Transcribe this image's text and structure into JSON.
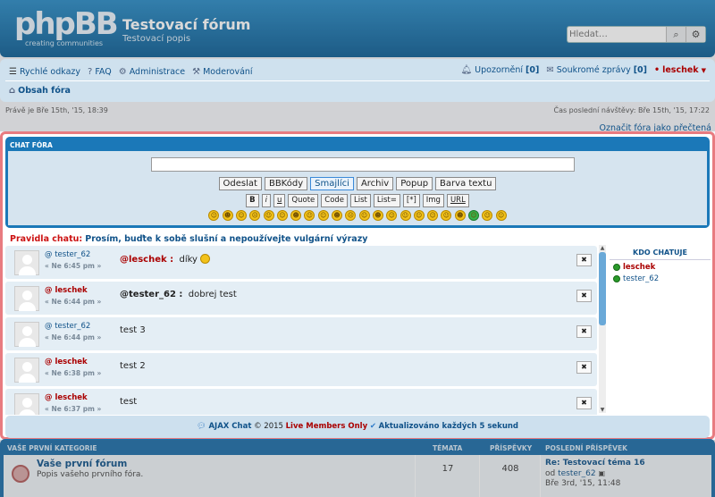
{
  "header": {
    "logo_text": "phpBB",
    "logo_sub": "creating communities",
    "site_title": "Testovací fórum",
    "site_desc": "Testovací popis",
    "search_placeholder": "Hledat…"
  },
  "nav": {
    "quick_links": "Rychlé odkazy",
    "faq": "FAQ",
    "admin": "Administrace",
    "moderate": "Moderování",
    "notifications": "Upozornění",
    "notifications_count": "[0]",
    "pm": "Soukromé zprávy",
    "pm_count": "[0]",
    "username": "leschek",
    "breadcrumb": "Obsah fóra"
  },
  "dates": {
    "now": "Právě je Bře 15th, '15, 18:39",
    "last_visit": "Čas poslední návštěvy: Bře 15th, '15, 17:22",
    "mark_read": "Označit fóra jako přečtená"
  },
  "chat": {
    "title": "CHAT FÓRA",
    "buttons_top": [
      "Odeslat",
      "BBKódy",
      "Smajlíci",
      "Archiv",
      "Popup",
      "Barva textu"
    ],
    "buttons_bb": [
      "B",
      "i",
      "u",
      "Quote",
      "Code",
      "List",
      "List=",
      "[*]",
      "Img",
      "URL"
    ],
    "smiley_count": 22,
    "rules_label": "Pravidla chatu:",
    "rules_text": "Prosím, buďte k sobě slušní a nepoužívejte vulgární výrazy",
    "messages": [
      {
        "user": "@ tester_62",
        "time": "« Ne 6:45 pm »",
        "to": "@leschek :",
        "text": "díky"
      },
      {
        "user": "@ leschek",
        "time": "« Ne 6:44 pm »",
        "to": "@tester_62 :",
        "text": "dobrej test"
      },
      {
        "user": "@ tester_62",
        "time": "« Ne 6:44 pm »",
        "to": "",
        "text": "test 3"
      },
      {
        "user": "@ leschek",
        "time": "« Ne 6:38 pm »",
        "to": "",
        "text": "test 2"
      },
      {
        "user": "@ leschek",
        "time": "« Ne 6:37 pm »",
        "to": "",
        "text": "test"
      }
    ],
    "delete_symbol": "✖",
    "online_title": "KDO CHATUJE",
    "online_users": [
      "leschek",
      "tester_62"
    ],
    "footer": {
      "ajax": "AJAX Chat",
      "copy": "© 2015",
      "live": "Live Members Only",
      "updated": "Aktualizováno každých 5 sekund"
    }
  },
  "forum": {
    "category": "VAŠE PRVNÍ KATEGORIE",
    "col_topics": "TÉMATA",
    "col_posts": "PŘÍSPĚVKY",
    "col_last": "POSLEDNÍ PŘÍSPĚVEK",
    "name": "Vaše první fórum",
    "desc": "Popis vašeho prvního fóra.",
    "topics": "17",
    "posts": "408",
    "last_title": "Re: Testovací téma 16",
    "last_by_prefix": "od",
    "last_by_user": "tester_62",
    "last_date": "Bře 3rd, '15, 11:48"
  },
  "colors": {
    "header": "#0f5f95",
    "chat_border": "#e87b80",
    "accent_red": "#aa0000",
    "link_blue": "#105289"
  }
}
